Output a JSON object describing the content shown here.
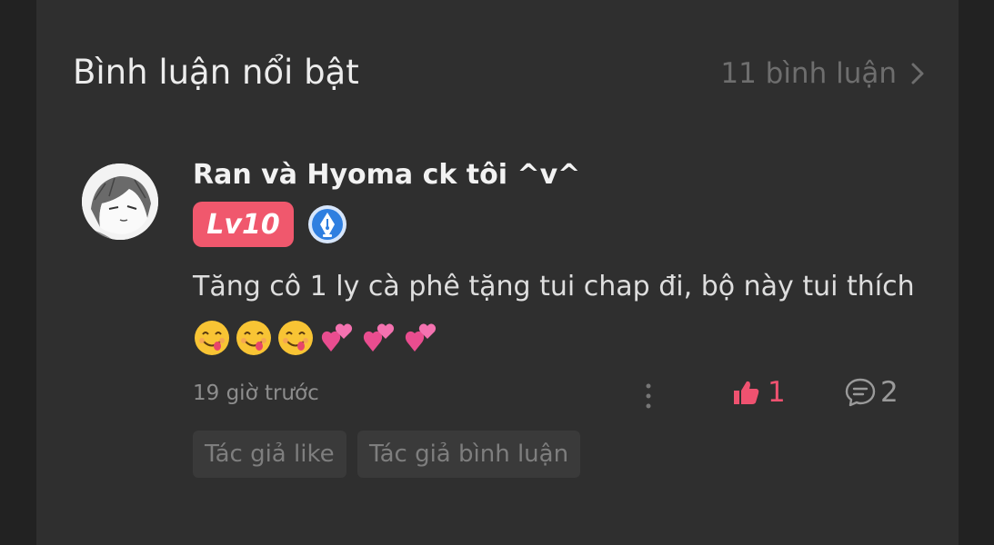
{
  "header": {
    "title": "Bình luận nổi bật",
    "comment_count": "11 bình luận"
  },
  "comment": {
    "username": "Ran và Hyoma ck tôi ^v^",
    "level_badge": "Lv10",
    "text": "Tăng cô 1 ly cà phê tặng tui chap đi, bộ này tui thích",
    "emojis": [
      "😋",
      "😋",
      "😋",
      "💞",
      "💞",
      "💞"
    ],
    "timestamp": "19 giờ trước",
    "like_count": "1",
    "reply_count": "2",
    "tags": [
      "Tác giả like",
      "Tác giả bình luận"
    ]
  },
  "icons": {
    "header_chevron": "chevron-right-icon",
    "author_pen": "pen-nib-icon",
    "more": "more-vertical-icon",
    "like": "thumbs-up-icon",
    "reply": "speech-bubble-icon"
  },
  "colors": {
    "background": "#222222",
    "panel": "#2f2f2f",
    "accent_pink": "#f0586d",
    "author_blue": "#2f7fe0"
  }
}
